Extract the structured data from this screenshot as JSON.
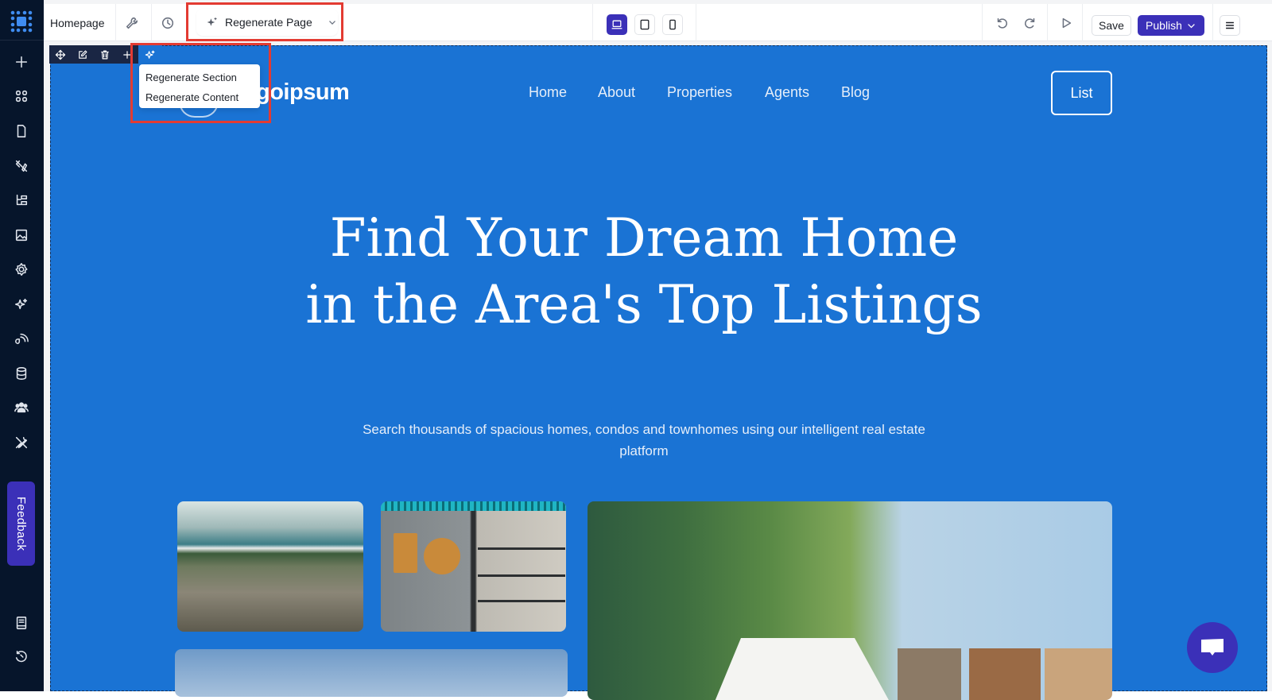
{
  "topbar": {
    "page_title": "Homepage",
    "regenerate_page_label": "Regenerate Page",
    "save_label": "Save",
    "publish_label": "Publish",
    "devices": [
      "desktop",
      "tablet",
      "mobile"
    ],
    "active_device": "desktop"
  },
  "sidebar": {
    "items": [
      "add",
      "sections",
      "pages",
      "design",
      "layers",
      "media",
      "settings",
      "ai",
      "integrations",
      "database",
      "members",
      "tools"
    ],
    "bottom_items": [
      "docs",
      "history"
    ],
    "feedback_label": "Feedback"
  },
  "section_toolbar": {
    "actions": [
      "move",
      "edit",
      "delete",
      "add",
      "ai-regenerate"
    ],
    "dropdown": [
      "Regenerate Section",
      "Regenerate Content"
    ]
  },
  "site": {
    "brand": "goipsum",
    "nav": [
      "Home",
      "About",
      "Properties",
      "Agents",
      "Blog"
    ],
    "cta_label": "List",
    "headline": "Find Your Dream Home in the Area's Top Listings",
    "subheadline": "Search thousands of spacious homes, condos and townhomes using our intelligent real estate platform",
    "images": [
      "aerial-town",
      "kitchen-shelves",
      "palm-trees-sky",
      "trees-tent-buildings"
    ]
  },
  "colors": {
    "accent": "#3b30b8",
    "hero_bg": "#1a73d4",
    "sidebar_bg": "#06152b",
    "highlight": "#e33b32"
  }
}
